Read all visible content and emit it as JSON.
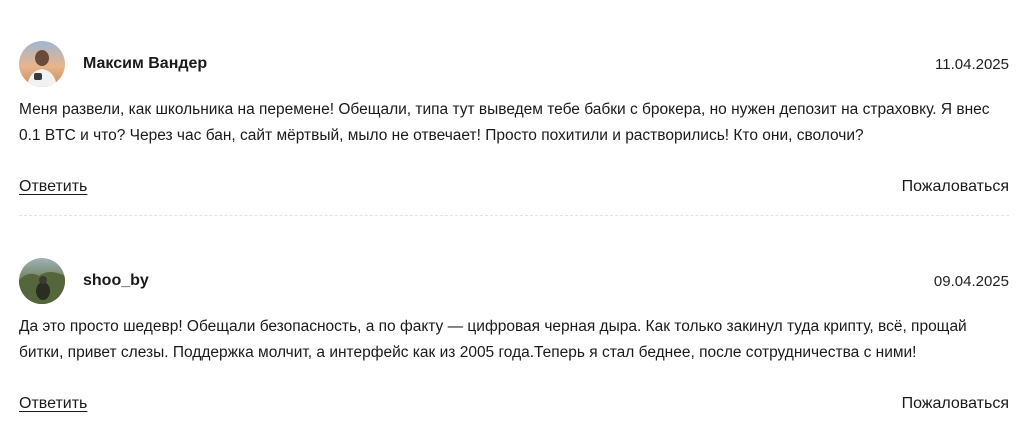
{
  "comments": [
    {
      "author": "Максим Вандер",
      "date": "11.04.2025",
      "text": "Меня развели, как школьника на перемене! Обещали, типа тут выведем тебе бабки с брокера, но нужен депозит на страховку. Я внес 0.1 BTC и что? Через час бан, сайт мёртвый, мыло не отвечает! Просто похитили и растворились! Кто они, сволочи?",
      "reply_label": "Ответить",
      "report_label": "Пожаловаться"
    },
    {
      "author": "shoo_by",
      "date": "09.04.2025",
      "text": "Да это просто шедевр! Обещали безопасность, а по факту — цифровая черная дыра. Как только закинул туда крипту, всё, прощай битки, привет слезы. Поддержка молчит, а интерфейс как из 2005 года.Теперь я стал беднее, после сотрудничества с ними!",
      "reply_label": "Ответить",
      "report_label": "Пожаловаться"
    }
  ]
}
